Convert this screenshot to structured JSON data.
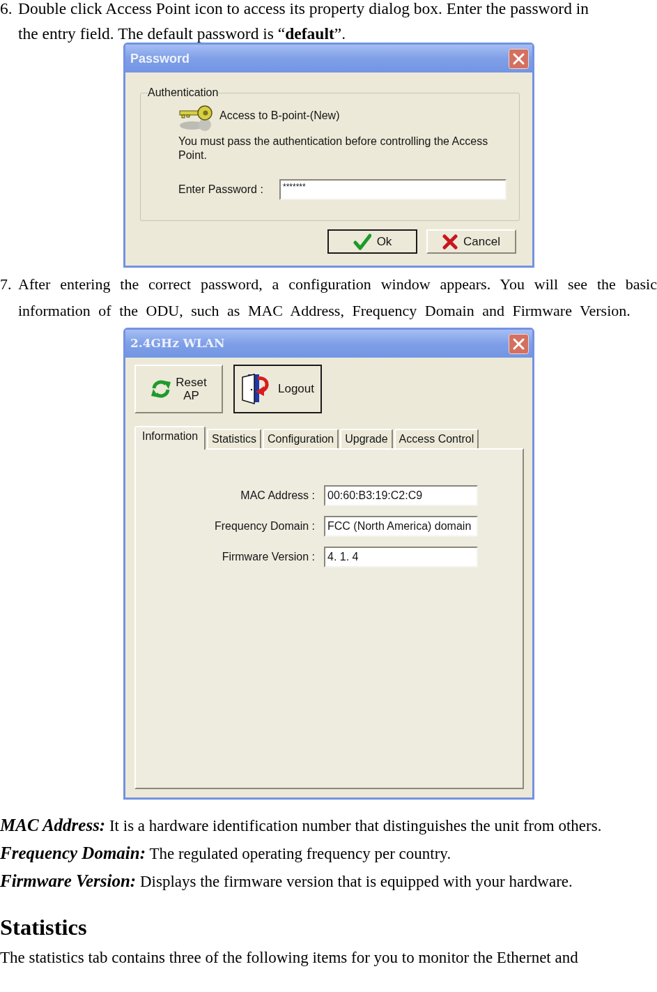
{
  "step_6": {
    "number": "6.",
    "text": "Double click Access Point icon to access its property dialog box. Enter the password in the entry field. The default password is “**default**”."
  },
  "password_dialog": {
    "title": "Password",
    "group_label": "Authentication",
    "heading": "Access to B-point-(New)",
    "message": "You must pass the authentication before controlling the Access Point.",
    "password_field": {
      "label": "Enter Password :",
      "value": "*******"
    },
    "buttons": [
      {
        "kind": "ok",
        "label": "Ok",
        "default": true
      },
      {
        "kind": "cancel",
        "label": "Cancel",
        "default": false
      }
    ]
  },
  "step_7": {
    "number": "7.",
    "text": "After entering the correct password, a configuration window appears. You will see the basic information of the ODU, such as MAC Address, Frequency Domain and Firmware Version."
  },
  "wlan_dialog": {
    "title": "2.4GHz WLAN",
    "toolbar": [
      {
        "kind": "reset",
        "label": "Reset AP",
        "default": false
      },
      {
        "kind": "logout",
        "label": "Logout",
        "default": true
      }
    ],
    "tabs": [
      {
        "label": "Information",
        "selected": true
      },
      {
        "label": "Statistics",
        "selected": false
      },
      {
        "label": "Configuration",
        "selected": false
      },
      {
        "label": "Upgrade",
        "selected": false
      },
      {
        "label": "Access Control",
        "selected": false
      }
    ],
    "fields": [
      {
        "label": "MAC Address :",
        "value": "00:60:B3:19:C2:C9"
      },
      {
        "label": "Frequency Domain :",
        "value": "FCC (North America) domain"
      },
      {
        "label": "Firmware Version :",
        "value": "4. 1. 4"
      }
    ]
  },
  "definitions": [
    {
      "term": "MAC Address:",
      "text": "It is a hardware identification number that distinguishes the unit from others."
    },
    {
      "term": "Frequency Domain:",
      "text": "The regulated operating frequency per country."
    },
    {
      "term": "Firmware Version:",
      "text": "Displays the firmware version that is equipped with your hardware."
    }
  ],
  "statistics": {
    "heading": "Statistics",
    "text": "The statistics tab contains three of the following items for you to monitor the Ethernet and"
  }
}
